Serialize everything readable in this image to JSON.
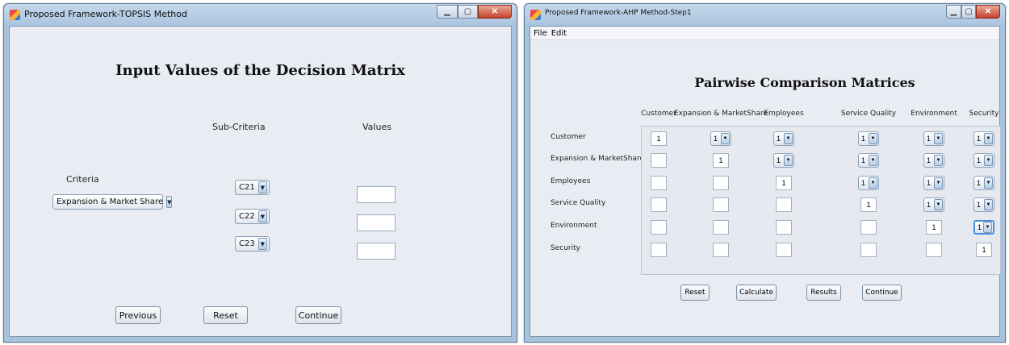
{
  "left_window": {
    "title": "Proposed Framework-TOPSIS Method",
    "heading": "Input Values of the Decision Matrix",
    "sub_criteria_header": "Sub-Criteria",
    "values_header": "Values",
    "criteria_label": "Criteria",
    "criteria_selected": "Expansion & Market Share",
    "sub_criteria": [
      "C21",
      "C22",
      "C23"
    ],
    "value_fields": [
      "",
      "",
      ""
    ],
    "buttons": {
      "previous": "Previous",
      "reset": "Reset",
      "continue": "Continue"
    }
  },
  "right_window": {
    "title": "Proposed Framework-AHP Method-Step1",
    "menu": [
      "File",
      "Edit"
    ],
    "heading": "Pairwise Comparison Matrices",
    "criteria": [
      "Customer",
      "Expansion & MarketShare",
      "Employees",
      "Service Quality",
      "Environment",
      "Security"
    ],
    "diagonal_value": "1",
    "dropdown_value": "1",
    "buttons": {
      "reset": "Reset",
      "calculate": "Calculate",
      "results": "Results",
      "continue": "Continue"
    }
  },
  "icons": {
    "window": "app-icon",
    "minimize": "minimize-icon",
    "maximize": "maximize-icon",
    "close": "close-icon",
    "dropdown": "chevron-down-icon"
  },
  "caption_glyphs": {
    "minimize": "▁",
    "maximize": "▢",
    "close": "✕",
    "dropdown_arrow": "▼"
  }
}
